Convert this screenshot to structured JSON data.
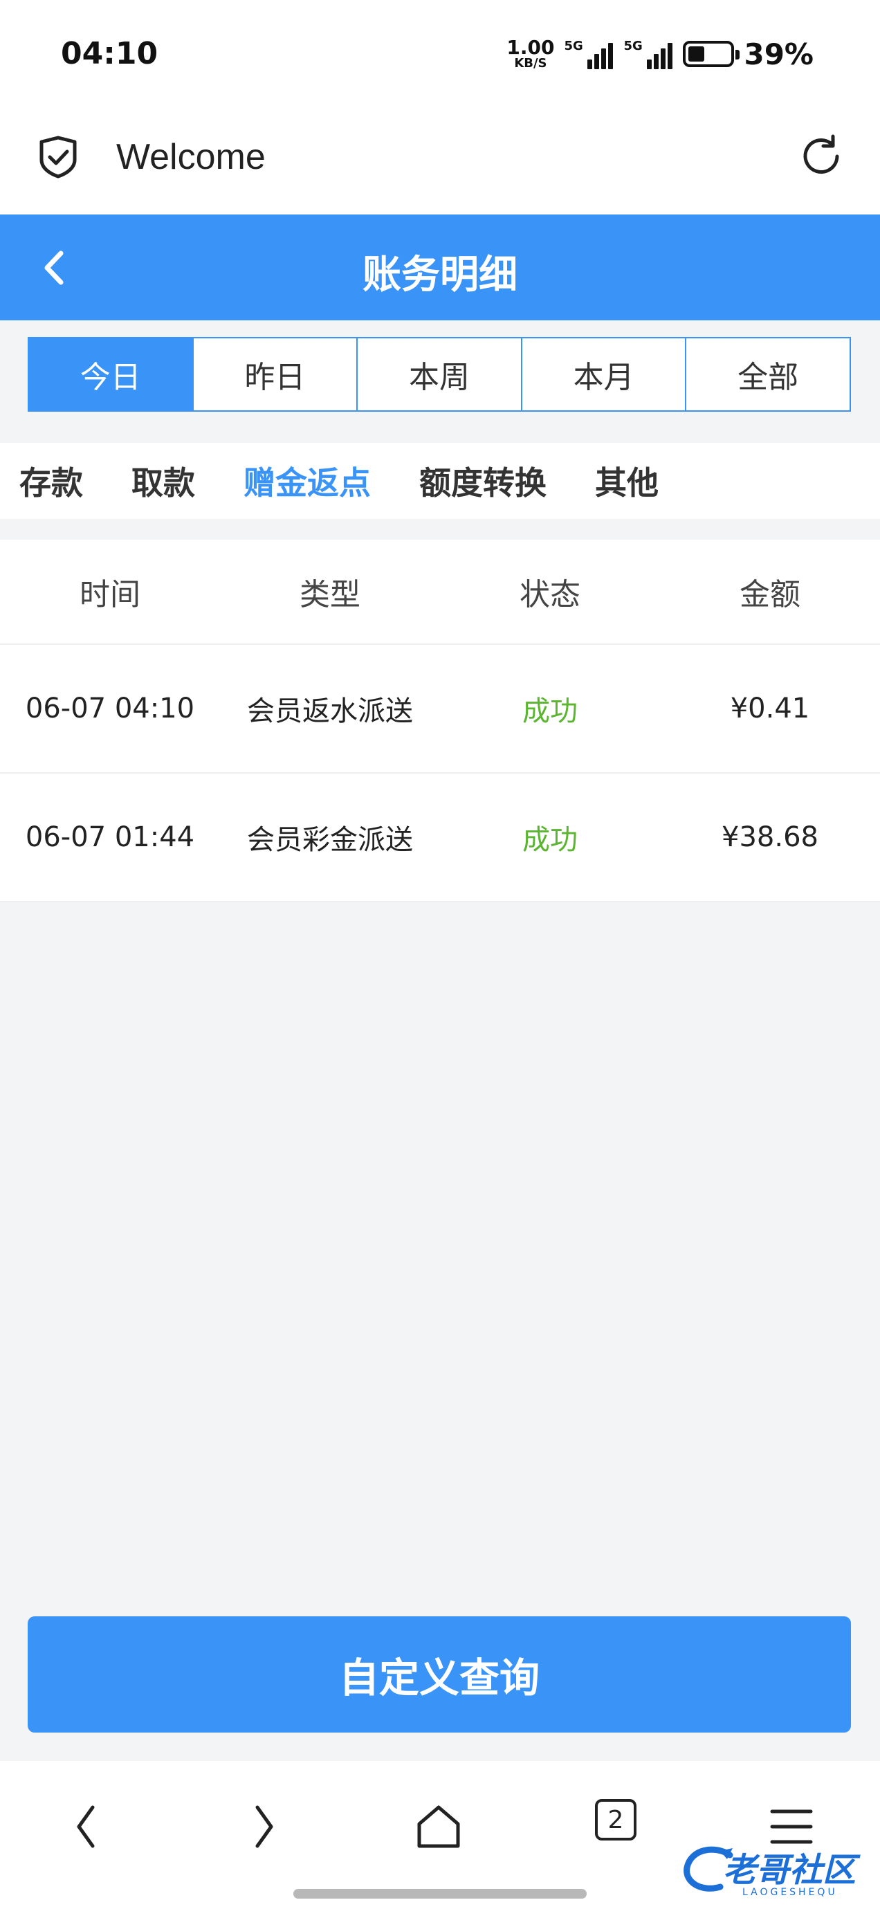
{
  "status_bar": {
    "time": "04:10",
    "net_speed": "1.00",
    "net_unit": "KB/S",
    "sim1_label": "5G",
    "sim2_label": "5G",
    "battery_level": 0.39,
    "battery_text": "39%"
  },
  "browser": {
    "title": "Welcome"
  },
  "header": {
    "title": "账务明细"
  },
  "periods": [
    {
      "label": "今日",
      "active": true
    },
    {
      "label": "昨日",
      "active": false
    },
    {
      "label": "本周",
      "active": false
    },
    {
      "label": "本月",
      "active": false
    },
    {
      "label": "全部",
      "active": false
    }
  ],
  "categories": [
    {
      "label": "存款",
      "active": false
    },
    {
      "label": "取款",
      "active": false
    },
    {
      "label": "赠金返点",
      "active": true
    },
    {
      "label": "额度转换",
      "active": false
    },
    {
      "label": "其他",
      "active": false
    }
  ],
  "table": {
    "headers": [
      "时间",
      "类型",
      "状态",
      "金额"
    ],
    "rows": [
      {
        "time": "06-07 04:10",
        "type": "会员返水派送",
        "status": "成功",
        "amount": "¥0.41"
      },
      {
        "time": "06-07 01:44",
        "type": "会员彩金派送",
        "status": "成功",
        "amount": "¥38.68"
      }
    ]
  },
  "query_button": "自定义查询",
  "bottom_nav": {
    "tab_count": "2"
  },
  "watermark": {
    "text": "老哥社区",
    "sub": "LAOGESHEQU"
  },
  "colors": {
    "primary": "#3a93f7",
    "success": "#5cb531"
  }
}
